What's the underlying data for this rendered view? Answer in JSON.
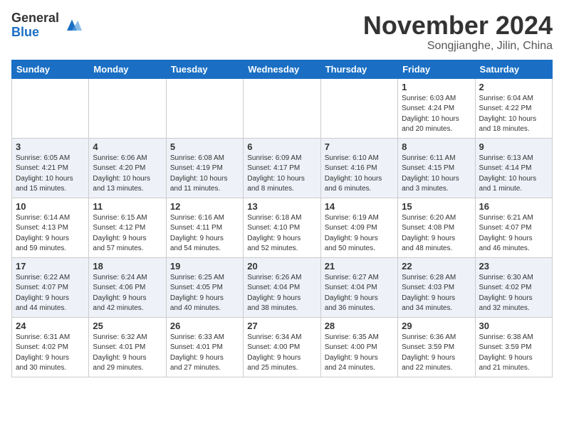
{
  "header": {
    "logo_general": "General",
    "logo_blue": "Blue",
    "month": "November 2024",
    "location": "Songjianghe, Jilin, China"
  },
  "weekdays": [
    "Sunday",
    "Monday",
    "Tuesday",
    "Wednesday",
    "Thursday",
    "Friday",
    "Saturday"
  ],
  "weeks": [
    [
      {
        "day": "",
        "info": ""
      },
      {
        "day": "",
        "info": ""
      },
      {
        "day": "",
        "info": ""
      },
      {
        "day": "",
        "info": ""
      },
      {
        "day": "",
        "info": ""
      },
      {
        "day": "1",
        "info": "Sunrise: 6:03 AM\nSunset: 4:24 PM\nDaylight: 10 hours\nand 20 minutes."
      },
      {
        "day": "2",
        "info": "Sunrise: 6:04 AM\nSunset: 4:22 PM\nDaylight: 10 hours\nand 18 minutes."
      }
    ],
    [
      {
        "day": "3",
        "info": "Sunrise: 6:05 AM\nSunset: 4:21 PM\nDaylight: 10 hours\nand 15 minutes."
      },
      {
        "day": "4",
        "info": "Sunrise: 6:06 AM\nSunset: 4:20 PM\nDaylight: 10 hours\nand 13 minutes."
      },
      {
        "day": "5",
        "info": "Sunrise: 6:08 AM\nSunset: 4:19 PM\nDaylight: 10 hours\nand 11 minutes."
      },
      {
        "day": "6",
        "info": "Sunrise: 6:09 AM\nSunset: 4:17 PM\nDaylight: 10 hours\nand 8 minutes."
      },
      {
        "day": "7",
        "info": "Sunrise: 6:10 AM\nSunset: 4:16 PM\nDaylight: 10 hours\nand 6 minutes."
      },
      {
        "day": "8",
        "info": "Sunrise: 6:11 AM\nSunset: 4:15 PM\nDaylight: 10 hours\nand 3 minutes."
      },
      {
        "day": "9",
        "info": "Sunrise: 6:13 AM\nSunset: 4:14 PM\nDaylight: 10 hours\nand 1 minute."
      }
    ],
    [
      {
        "day": "10",
        "info": "Sunrise: 6:14 AM\nSunset: 4:13 PM\nDaylight: 9 hours\nand 59 minutes."
      },
      {
        "day": "11",
        "info": "Sunrise: 6:15 AM\nSunset: 4:12 PM\nDaylight: 9 hours\nand 57 minutes."
      },
      {
        "day": "12",
        "info": "Sunrise: 6:16 AM\nSunset: 4:11 PM\nDaylight: 9 hours\nand 54 minutes."
      },
      {
        "day": "13",
        "info": "Sunrise: 6:18 AM\nSunset: 4:10 PM\nDaylight: 9 hours\nand 52 minutes."
      },
      {
        "day": "14",
        "info": "Sunrise: 6:19 AM\nSunset: 4:09 PM\nDaylight: 9 hours\nand 50 minutes."
      },
      {
        "day": "15",
        "info": "Sunrise: 6:20 AM\nSunset: 4:08 PM\nDaylight: 9 hours\nand 48 minutes."
      },
      {
        "day": "16",
        "info": "Sunrise: 6:21 AM\nSunset: 4:07 PM\nDaylight: 9 hours\nand 46 minutes."
      }
    ],
    [
      {
        "day": "17",
        "info": "Sunrise: 6:22 AM\nSunset: 4:07 PM\nDaylight: 9 hours\nand 44 minutes."
      },
      {
        "day": "18",
        "info": "Sunrise: 6:24 AM\nSunset: 4:06 PM\nDaylight: 9 hours\nand 42 minutes."
      },
      {
        "day": "19",
        "info": "Sunrise: 6:25 AM\nSunset: 4:05 PM\nDaylight: 9 hours\nand 40 minutes."
      },
      {
        "day": "20",
        "info": "Sunrise: 6:26 AM\nSunset: 4:04 PM\nDaylight: 9 hours\nand 38 minutes."
      },
      {
        "day": "21",
        "info": "Sunrise: 6:27 AM\nSunset: 4:04 PM\nDaylight: 9 hours\nand 36 minutes."
      },
      {
        "day": "22",
        "info": "Sunrise: 6:28 AM\nSunset: 4:03 PM\nDaylight: 9 hours\nand 34 minutes."
      },
      {
        "day": "23",
        "info": "Sunrise: 6:30 AM\nSunset: 4:02 PM\nDaylight: 9 hours\nand 32 minutes."
      }
    ],
    [
      {
        "day": "24",
        "info": "Sunrise: 6:31 AM\nSunset: 4:02 PM\nDaylight: 9 hours\nand 30 minutes."
      },
      {
        "day": "25",
        "info": "Sunrise: 6:32 AM\nSunset: 4:01 PM\nDaylight: 9 hours\nand 29 minutes."
      },
      {
        "day": "26",
        "info": "Sunrise: 6:33 AM\nSunset: 4:01 PM\nDaylight: 9 hours\nand 27 minutes."
      },
      {
        "day": "27",
        "info": "Sunrise: 6:34 AM\nSunset: 4:00 PM\nDaylight: 9 hours\nand 25 minutes."
      },
      {
        "day": "28",
        "info": "Sunrise: 6:35 AM\nSunset: 4:00 PM\nDaylight: 9 hours\nand 24 minutes."
      },
      {
        "day": "29",
        "info": "Sunrise: 6:36 AM\nSunset: 3:59 PM\nDaylight: 9 hours\nand 22 minutes."
      },
      {
        "day": "30",
        "info": "Sunrise: 6:38 AM\nSunset: 3:59 PM\nDaylight: 9 hours\nand 21 minutes."
      }
    ]
  ]
}
